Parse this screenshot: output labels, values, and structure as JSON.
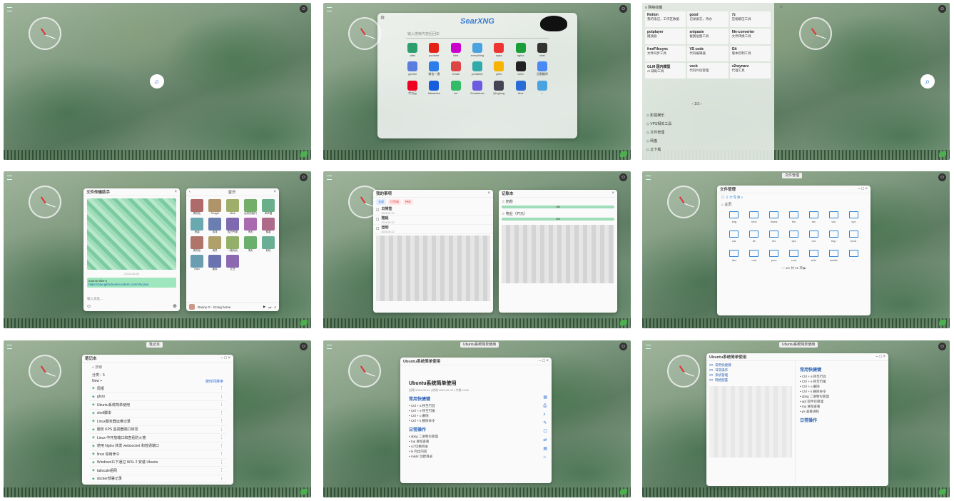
{
  "panels": {
    "p2": {
      "brand": "SearXNG",
      "search_placeholder": "输入搜索内容后回车",
      "apps": [
        "alist",
        "youtube",
        "iobit",
        "everything",
        "nyaa",
        "nginx",
        "chat",
        "gemini",
        "微信一通",
        "Gmail",
        "portainer",
        "pixiv",
        "v2ex",
        "谷歌翻译",
        "华为云",
        "bitwarden",
        "xui",
        "Excalidraw",
        "Qinglong",
        "ttrss",
        "+"
      ]
    },
    "p3": {
      "cards": [
        {
          "title": "Notion",
          "sub": "我的笔记，工作区数据"
        },
        {
          "title": "good",
          "sub": "记录备忘，待办"
        },
        {
          "title": "7z",
          "sub": "压缩解压工具"
        },
        {
          "title": "potplayer",
          "sub": "播放器"
        },
        {
          "title": "snipaste",
          "sub": "截图贴图工具"
        },
        {
          "title": "file-converter",
          "sub": "文件转换工具"
        },
        {
          "title": "freeFilesync",
          "sub": "文件同步工具"
        },
        {
          "title": "VS code",
          "sub": "代码编辑器"
        },
        {
          "title": "Git",
          "sub": "版本控制工具"
        },
        {
          "title": "GLM 国内模型",
          "sub": "AI 辅助工具"
        },
        {
          "title": "vscb",
          "sub": "代码片段管理"
        },
        {
          "title": "v2raynarv",
          "sub": "代理工具"
        }
      ],
      "pager": "1/3",
      "nav_items": [
        "影视娱乐",
        "VPS相关工具",
        "文件管理",
        "网盘",
        "云下载"
      ]
    },
    "p4": {
      "chat_title": "文件传输助手",
      "chat_date": "2024-03-28",
      "chat_link_label": "source-dev-x",
      "chat_link": "https://raw.githubusercontent.com/x/tv.json",
      "input_placeholder": "输入消息...",
      "music_title": "音乐",
      "now_playing": "Danny G - Going home",
      "albums": [
        "周杰伦",
        "Tonight",
        "Mine",
        "后来的我们",
        "声声慢",
        "夜曲",
        "泡沫",
        "告白气球",
        "晴天",
        "稻香",
        "周杰伦",
        "演员",
        "一路向北",
        "晴天",
        "彩虹",
        "Rain",
        "喜欢",
        "红豆"
      ]
    },
    "p5": {
      "todo_title": "我的事项",
      "todo_tags": [
        "全部",
        "已完成",
        "待办"
      ],
      "todos": [
        {
          "t": "日常签",
          "d": "2024-05-13"
        },
        {
          "t": "拖延",
          "d": "2024-05-12"
        },
        {
          "t": "运动",
          "d": "2024-05-12"
        }
      ],
      "ledger_title": "记账本",
      "ledger_items": [
        {
          "t": "奶粉",
          "a": "150"
        },
        {
          "t": "物业（开元）",
          "a": "300"
        }
      ]
    },
    "p6": {
      "tab": "文件管理",
      "title": "文件管理",
      "crumb": "主页",
      "folders": [
        "img",
        "mov",
        "home",
        "bin",
        "etc",
        "var",
        "opt",
        "usr",
        "lib",
        "srv",
        "sys",
        "run",
        "tmp",
        "boot",
        "dev",
        "mnt",
        "proc",
        "root",
        "sbin",
        "media",
        "...."
      ],
      "pager": "1/1 共 21 项"
    },
    "p7": {
      "tab": "笔记本",
      "title": "笔记本",
      "search": "搜索",
      "section": "分类：5",
      "new_label": "New +",
      "filter": "按时间排序",
      "notes": [
        "周报",
        "ghoti",
        "Ubuntu系统简单使用",
        "shell脚本",
        "Linux服务器运维记录",
        "服务 KPS 监视器端口转发",
        "Linux 中开放端口和查看防火墙",
        "使用 Nginx 转发 websocket 和普通端口",
        "linux 常用命令",
        "Windows11下通过 WSL 2 安装 Ubuntu",
        "tailscale组网",
        "docker部署记录"
      ]
    },
    "p8": {
      "tab": "Ubuntu系统简单使用",
      "title": "Ubuntu系统简单使用",
      "h1": "Ubuntu系统简单使用",
      "meta": "创建 2024-05-12 | 修改 2024-05-12 | 字数 1245",
      "sec1": "常用快捷键",
      "keys": [
        "Ctrl + a  移至行首",
        "Ctrl + e  移至行尾",
        "Ctrl + u  删除",
        "Ctrl + k  删除命令"
      ],
      "sec2": "日常操作",
      "ops": [
        "dpkg  二进制包管理",
        "top  进程查看",
        "cd  切换目录",
        "ls  列出内容",
        "mkdir  创建目录"
      ]
    },
    "p9": {
      "tab": "Ubuntu系统简单使用",
      "title": "Ubuntu系统简单使用",
      "toc": [
        "常用快捷键",
        "日常操作",
        "系统管理",
        "网络配置"
      ],
      "h_keys": "常用快捷键",
      "h_ops": "日常操作",
      "preview": [
        "Ctrl + a  移至行首",
        "Ctrl + e  移至行尾",
        "Ctrl + u  删除",
        "Ctrl + k  删除命令",
        "dpkg  二进制包管理",
        "apt  软件包管理",
        "top  进程查看",
        "ps  查看进程"
      ]
    }
  }
}
